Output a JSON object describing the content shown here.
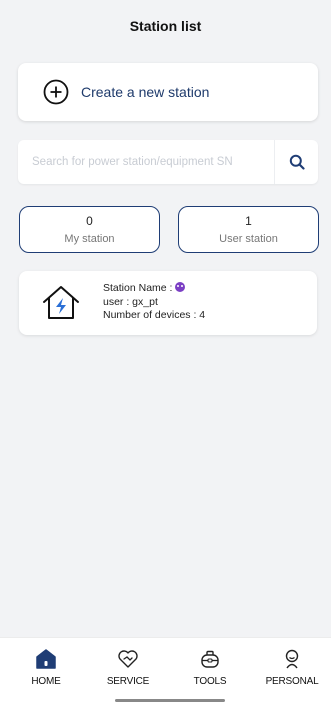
{
  "header": {
    "title": "Station list"
  },
  "create": {
    "label": "Create a new station",
    "icon": "circle-plus-icon"
  },
  "search": {
    "placeholder": "Search for power station/equipment SN",
    "icon": "search-icon"
  },
  "tabs": [
    {
      "count": "0",
      "label": "My station"
    },
    {
      "count": "1",
      "label": "User station"
    }
  ],
  "station": {
    "name_label": "Station Name :",
    "name_emoji": "smiling-devil-emoji",
    "user_line": "user : gx_pt",
    "devices_line": "Number of devices : 4",
    "icon": "house-bolt-icon"
  },
  "nav": [
    {
      "label": "HOME",
      "icon": "home-icon",
      "active": true
    },
    {
      "label": "SERVICE",
      "icon": "heart-handshake-icon",
      "active": false
    },
    {
      "label": "TOOLS",
      "icon": "toolbox-icon",
      "active": false
    },
    {
      "label": "PERSONAL",
      "icon": "person-icon",
      "active": false
    }
  ],
  "colors": {
    "accent": "#1f3d75",
    "bolt": "#2a6fd6",
    "background": "#f2f3f5"
  }
}
